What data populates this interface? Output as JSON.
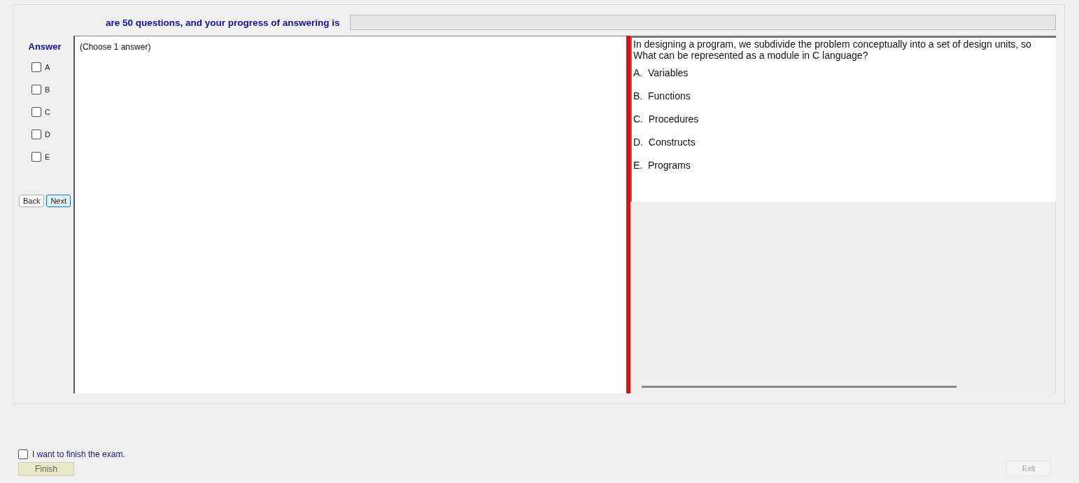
{
  "header": {
    "text": "are 50 questions, and your progress of answering is",
    "progress": {
      "level": 0
    }
  },
  "answer_panel": {
    "title": "Answer",
    "options": [
      {
        "label": "A",
        "checked": false
      },
      {
        "label": "B",
        "checked": false
      },
      {
        "label": "C",
        "checked": false
      },
      {
        "label": "D",
        "checked": false
      },
      {
        "label": "E",
        "checked": false
      }
    ],
    "buttons": [
      {
        "label": "Back",
        "focused": false
      },
      {
        "label": "Next",
        "focused": true
      }
    ]
  },
  "answer_area": {
    "hint": "(Choose 1 answer)"
  },
  "question": {
    "lines": [
      "In designing a program, we subdivide the problem conceptually into a set of design units, so",
      "What can be represented as a module in C language?"
    ],
    "choices": [
      "A.  Variables",
      "B.  Functions",
      "C.  Procedures",
      "D.  Constructs",
      "E.  Programs"
    ]
  },
  "finish": {
    "label": "I want to finish the exam.",
    "checked": false,
    "button": "Finish"
  },
  "exit": {
    "label": "Exit",
    "disabled": true
  }
}
